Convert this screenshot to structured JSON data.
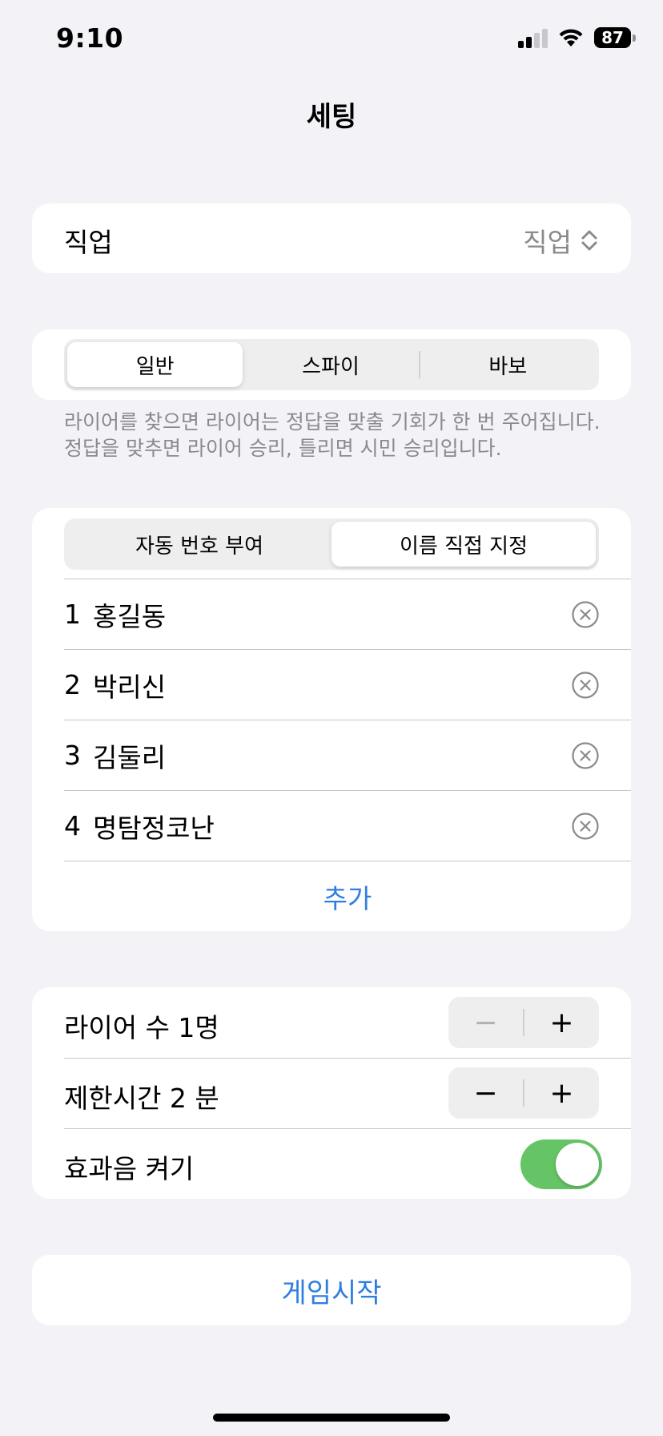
{
  "status_bar": {
    "time": "9:10",
    "battery_level": "87",
    "icons": [
      "signal-icon",
      "wifi-icon",
      "battery-icon"
    ]
  },
  "title": "세팅",
  "job": {
    "label": "직업",
    "value": "직업",
    "icon": "chevron-up-down-icon"
  },
  "mode": {
    "options": [
      "일반",
      "스파이",
      "바보"
    ],
    "selected_index": 0,
    "footer": [
      "라이어를 찾으면 라이어는 정답을 맞출 기회가 한 번 주어집니다.",
      "정답을 맞추면 라이어 승리, 틀리면 시민 승리입니다."
    ]
  },
  "naming": {
    "options": [
      "자동 번호 부여",
      "이름 직접 지정"
    ],
    "selected_index": 1
  },
  "players": [
    {
      "num": "1",
      "name": "홍길동"
    },
    {
      "num": "2",
      "name": "박리신"
    },
    {
      "num": "3",
      "name": "김둘리"
    },
    {
      "num": "4",
      "name": "명탐정코난"
    }
  ],
  "add_label": "추가",
  "options": {
    "liar_count_label": "라이어 수 1명",
    "liar_count": 1,
    "time_limit_label": "제한시간 2 분",
    "time_limit": 2,
    "minus": "−",
    "plus": "+",
    "sound_label": "효과음 켜기",
    "sound_on": true
  },
  "start_label": "게임시작",
  "colors": {
    "background": "#f2f2f7",
    "accent": "#2f7fe0",
    "toggle_on": "#65c466",
    "secondary_text": "#8a8a8e"
  }
}
